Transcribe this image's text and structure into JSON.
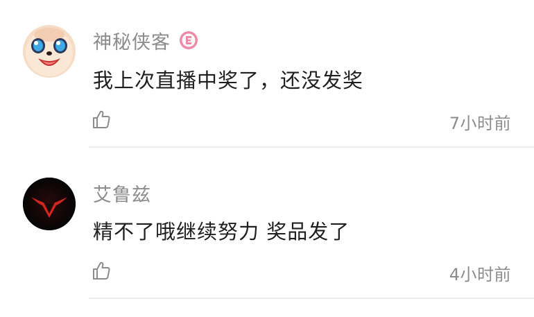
{
  "comments": [
    {
      "username": "神秘侠客",
      "level_badge_icon": "level-badge-pink",
      "text": "我上次直播中奖了，还没发奖",
      "time": "7小时前",
      "avatar_icon": "cartoon-face-avatar",
      "like_icon": "thumbs-up-outline"
    },
    {
      "username": "艾鲁兹",
      "text": "精不了哦继续努力 奖品发了",
      "time": "4小时前",
      "avatar_icon": "geass-sigil-avatar",
      "like_icon": "thumbs-up-outline"
    }
  ],
  "colors": {
    "username": "#8c8c8c",
    "text": "#1f1f1f",
    "time": "#8c8c8c",
    "divider": "#ececec",
    "badge": "#f08aa6"
  }
}
